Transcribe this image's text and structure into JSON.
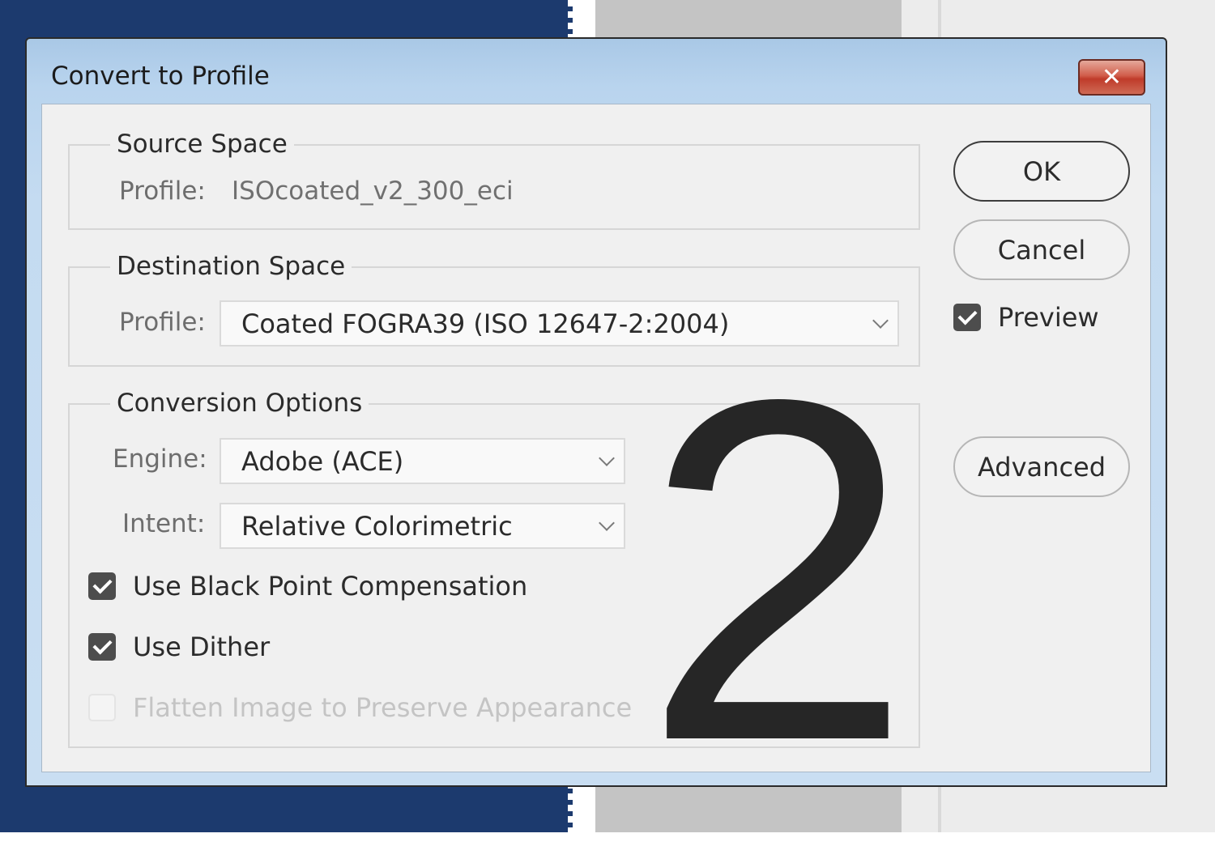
{
  "dialog": {
    "title": "Convert to Profile",
    "close_symbol": "✕",
    "close_icon": "close-icon"
  },
  "source_space": {
    "legend": "Source Space",
    "profile_label": "Profile:",
    "profile_value": "ISOcoated_v2_300_eci"
  },
  "destination_space": {
    "legend": "Destination Space",
    "profile_label": "Profile:",
    "profile_selected": "Coated FOGRA39 (ISO 12647-2:2004)"
  },
  "conversion_options": {
    "legend": "Conversion Options",
    "engine_label": "Engine:",
    "engine_selected": "Adobe (ACE)",
    "intent_label": "Intent:",
    "intent_selected": "Relative Colorimetric",
    "checkboxes": [
      {
        "label": "Use Black Point Compensation",
        "checked": true,
        "enabled": true
      },
      {
        "label": "Use Dither",
        "checked": true,
        "enabled": true
      },
      {
        "label": "Flatten Image to Preserve Appearance",
        "checked": false,
        "enabled": false
      }
    ]
  },
  "buttons": {
    "ok": "OK",
    "cancel": "Cancel",
    "advanced": "Advanced"
  },
  "preview": {
    "label": "Preview",
    "checked": true
  },
  "overlay": {
    "step_number": "2"
  },
  "colors": {
    "desktop_blue": "#1c3a6e",
    "titlebar": "#b9d4ee",
    "close_red": "#c9483a",
    "dialog_bg": "#f0f0f0"
  }
}
